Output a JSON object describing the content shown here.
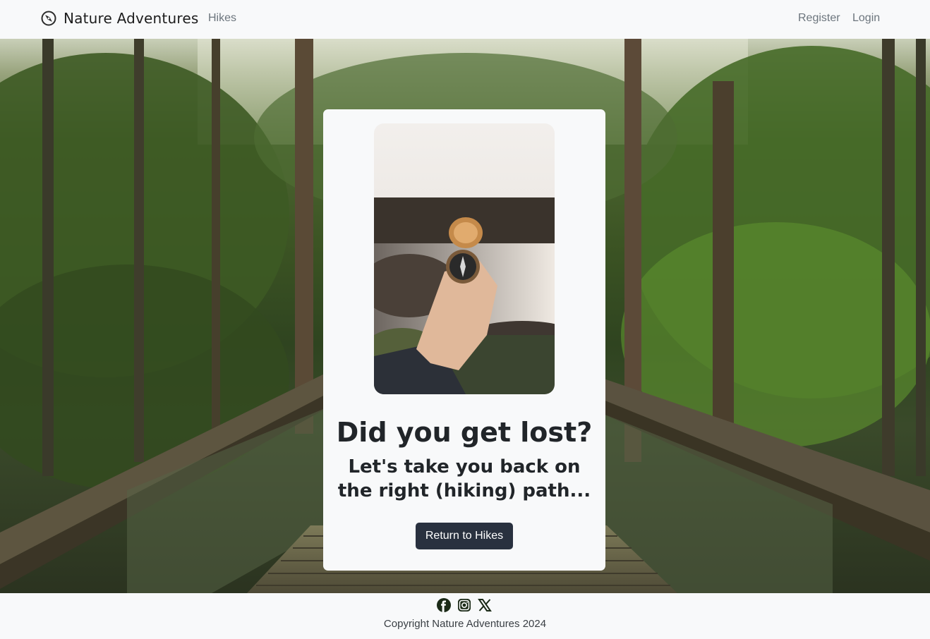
{
  "navbar": {
    "brand_icon": "compass-icon",
    "brand": "Nature Adventures",
    "links": {
      "hikes": "Hikes",
      "register": "Register",
      "login": "Login"
    }
  },
  "hero": {
    "background": "forest-bridge-photo"
  },
  "card": {
    "photo": "hand-holding-compass-photo",
    "heading": "Did you get lost?",
    "subheading": "Let's take you back on the right (hiking) path...",
    "button": "Return to Hikes"
  },
  "footer": {
    "social_icons": [
      "facebook-icon",
      "instagram-icon",
      "x-icon"
    ],
    "copyright": "Copyright Nature Adventures 2024"
  },
  "colors": {
    "navbar_bg": "#f8f9fa",
    "button_bg": "#29313f",
    "text": "#212529",
    "link": "#6c757d"
  }
}
